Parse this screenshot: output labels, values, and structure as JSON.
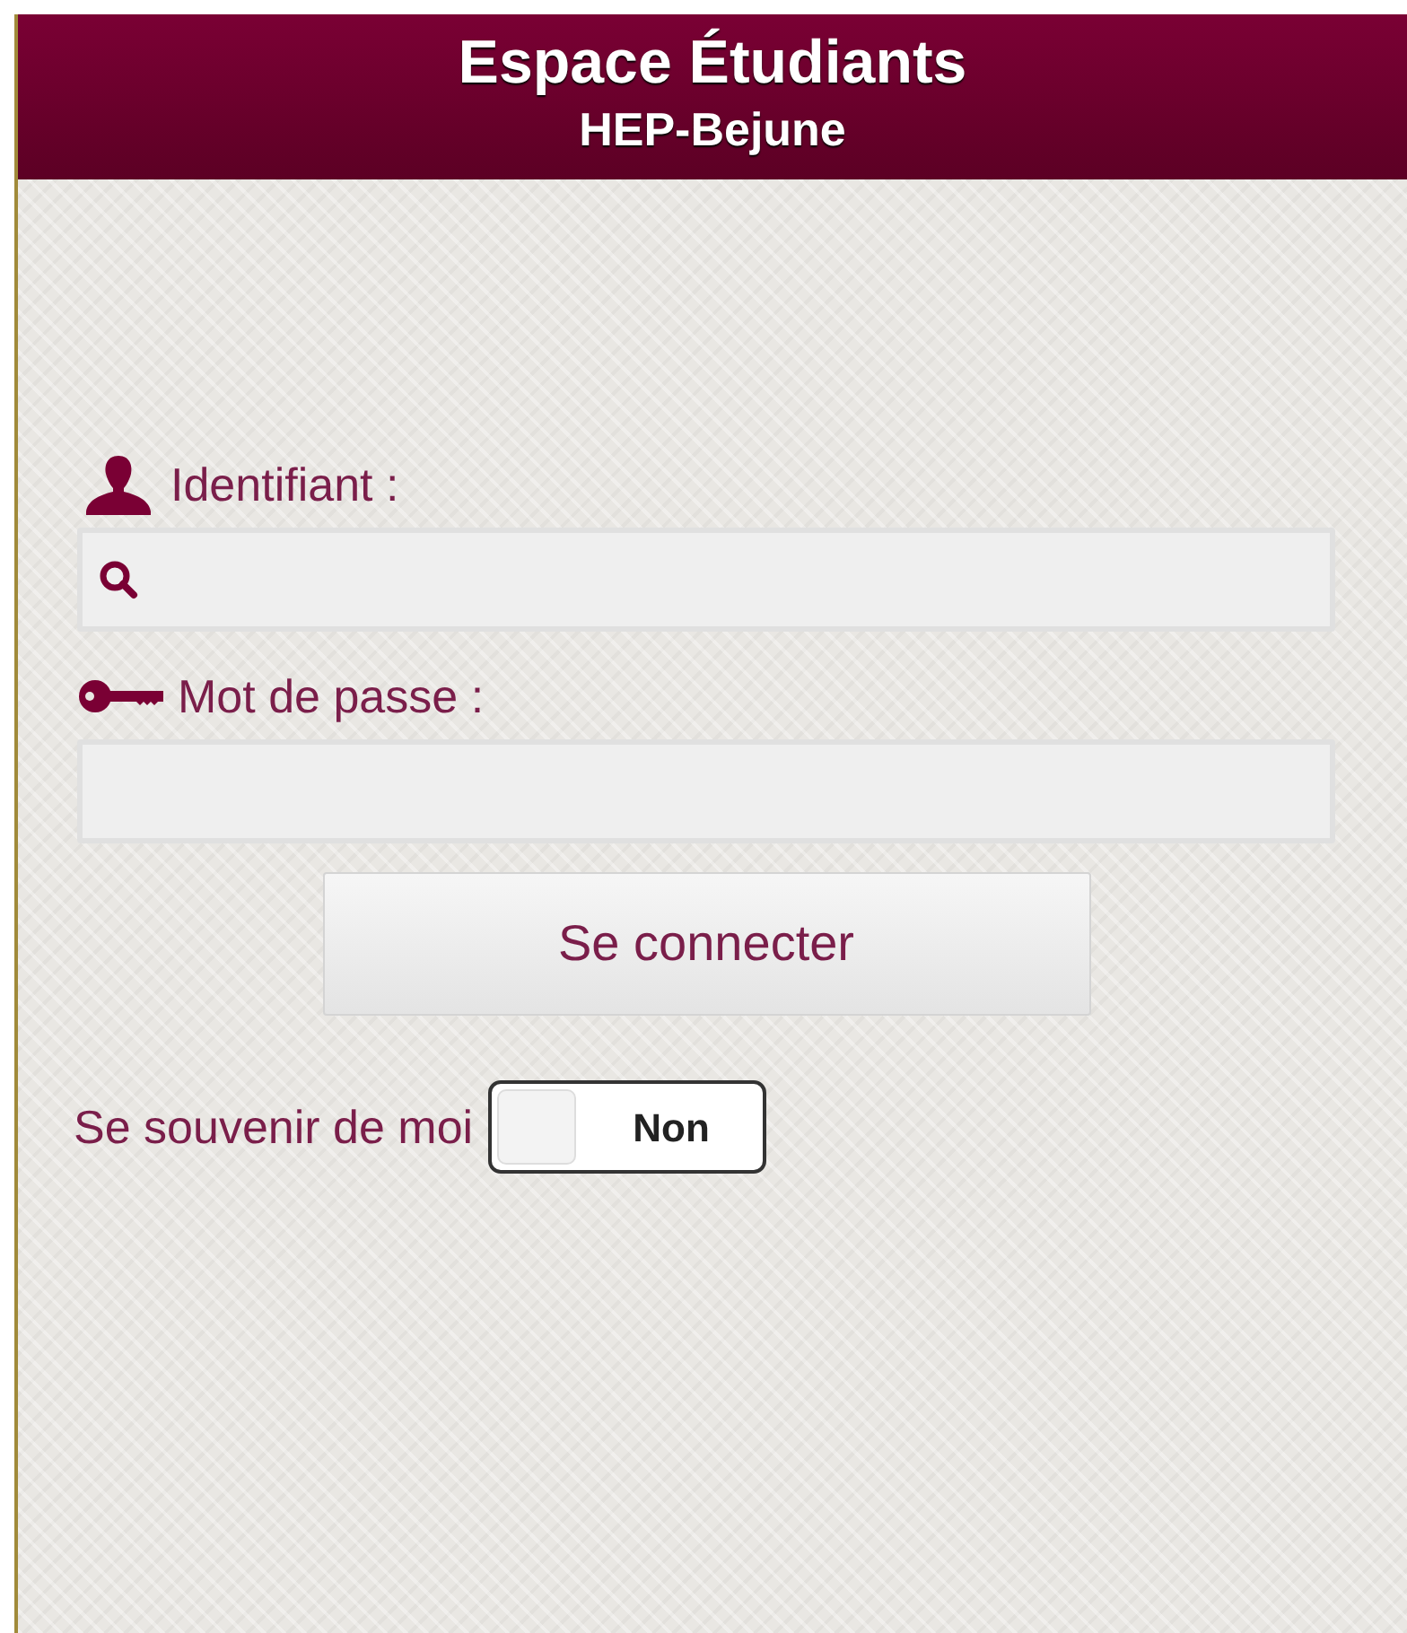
{
  "header": {
    "title": "Espace Étudiants",
    "subtitle": "HEP-Bejune"
  },
  "fields": [
    {
      "label": "Identifiant :"
    },
    {
      "label": "Mot de passe :"
    }
  ],
  "login_button": "Se connecter",
  "remember": {
    "label": "Se souvenir de moi",
    "on": false,
    "state_text": "Non"
  }
}
